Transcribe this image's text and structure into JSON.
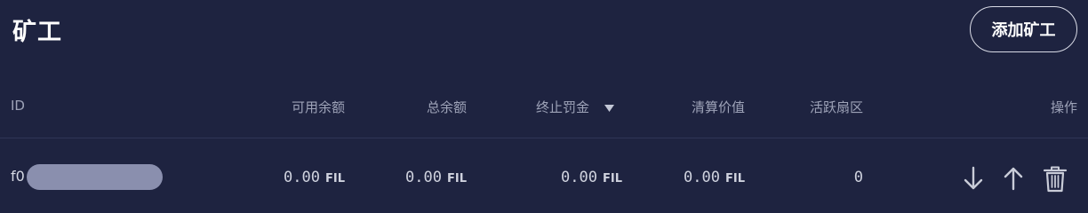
{
  "header": {
    "title": "矿工",
    "add_button_label": "添加矿工"
  },
  "table": {
    "columns": {
      "id": "ID",
      "available": "可用余额",
      "total": "总余额",
      "penalty": "终止罚金",
      "liquidation": "清算价值",
      "active_sectors": "活跃扇区",
      "actions": "操作"
    },
    "sort_icon": "caret-down-icon",
    "rows": [
      {
        "id_prefix": "f0",
        "available": "0.00",
        "total": "0.00",
        "penalty": "0.00",
        "liquidation": "0.00",
        "unit": "FIL",
        "active_sectors": "0",
        "actions": [
          "arrow-down-icon",
          "arrow-up-icon",
          "trash-icon"
        ]
      }
    ]
  },
  "colors": {
    "background": "#1e2340",
    "header_text": "#9ea3b8",
    "redaction": "#8a8fae"
  }
}
